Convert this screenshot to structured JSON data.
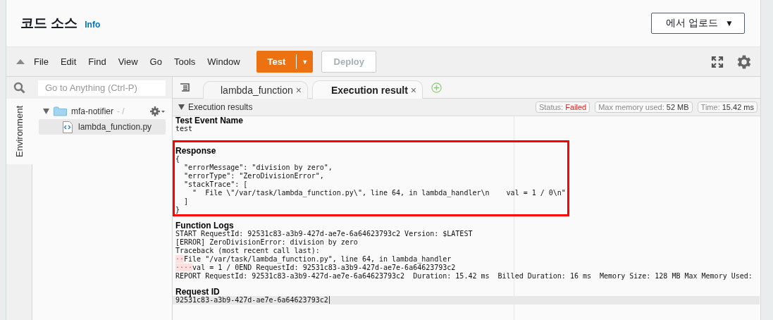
{
  "header": {
    "title": "코드 소스",
    "info_link": "Info",
    "upload_button": {
      "label": "에서 업로드",
      "caret": "▼"
    }
  },
  "toolbar": {
    "menus": [
      "File",
      "Edit",
      "Find",
      "View",
      "Go",
      "Tools",
      "Window"
    ],
    "test_button": {
      "label": "Test",
      "caret": "▼"
    },
    "deploy_button": {
      "label": "Deploy",
      "disabled": true
    }
  },
  "sidebar": {
    "search": {
      "placeholder": "Go to Anything (Ctrl-P)"
    },
    "side_tabs": [
      {
        "label": "Environment",
        "selected": true
      }
    ],
    "tree": [
      {
        "kind": "folder",
        "name": "mfa-notifier",
        "suffix": "- /",
        "expanded": true,
        "selected": false,
        "children": [
          {
            "kind": "file",
            "name": "lambda_function.py",
            "selected": true
          }
        ]
      }
    ]
  },
  "editor_tabs": [
    {
      "label": "lambda_function",
      "selected": false,
      "close": "×"
    },
    {
      "label": "Execution result",
      "selected": true,
      "close": "×"
    }
  ],
  "results": {
    "title": "Execution results",
    "expanded": true,
    "pills": [
      {
        "kind": "status",
        "label": "Status:",
        "value": "Failed"
      },
      {
        "kind": "plain",
        "label": "Max memory used:",
        "value": "52 MB"
      },
      {
        "kind": "plain",
        "label": "Time:",
        "value": "15.42 ms"
      }
    ],
    "sections": [
      {
        "heading": "Test Event Name",
        "highlighted": false,
        "lines": [
          {
            "text": "test"
          }
        ]
      },
      {
        "heading": "Response",
        "highlighted": true,
        "lines": [
          {
            "text": "{"
          },
          {
            "text": "  \"errorMessage\": \"division by zero\","
          },
          {
            "text": "  \"errorType\": \"ZeroDivisionError\","
          },
          {
            "text": "  \"stackTrace\": ["
          },
          {
            "text": "    \"  File \\\"/var/task/lambda_function.py\\\", line 64, in lambda_handler\\n    val = 1 / 0\\n\""
          },
          {
            "text": "  ]"
          },
          {
            "text": "}"
          }
        ]
      },
      {
        "heading": "Function Logs",
        "highlighted": false,
        "lines": [
          {
            "text": "START RequestId: 92531c83-a3b9-427d-ae7e-6a64623793c2 Version: $LATEST"
          },
          {
            "text": "[ERROR] ZeroDivisionError: division by zero"
          },
          {
            "text": "Traceback (most recent call last):"
          },
          {
            "marker": "··",
            "text": "File \"/var/task/lambda_function.py\", line 64, in lambda_handler"
          },
          {
            "marker": "····",
            "text": "val = 1 / 0END RequestId: 92531c83-a3b9-427d-ae7e-6a64623793c2"
          },
          {
            "text": "REPORT RequestId: 92531c83-a3b9-427d-ae7e-6a64623793c2  Duration: 15.42 ms  Billed Duration: 16 ms  Memory Size: 128 MB Max Memory Used:"
          }
        ]
      },
      {
        "heading": "Request ID",
        "highlighted": false,
        "lines": [
          {
            "text": "92531c83-a3b9-427d-ae7e-6a64623793c2",
            "current": true
          }
        ]
      }
    ]
  }
}
